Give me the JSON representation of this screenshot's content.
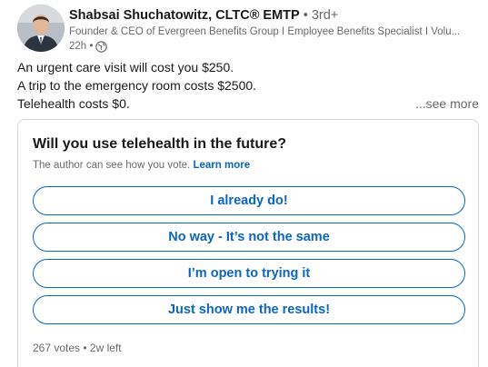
{
  "author": {
    "name": "Shabsai Shuchatowitz, CLTC® EMTP",
    "degree": " • 3rd+",
    "headline": "Founder & CEO of Evergreen Benefits Group I Employee Benefits Specialist I Volu...",
    "time": "22h •",
    "visibility_icon": "globe-icon"
  },
  "post": {
    "lines": [
      "An urgent care visit will cost you $250.",
      "A trip to the emergency room costs $2500.",
      "Telehealth costs $0."
    ],
    "see_more": "...see more"
  },
  "poll": {
    "question": "Will you use telehealth in the future?",
    "note": "The author can see how you vote.",
    "learn_more": "Learn more",
    "options": [
      "I already do!",
      "No way - It’s not the same",
      "I’m open to trying it",
      "Just show me the results!"
    ],
    "votes": "267 votes",
    "separator": " • ",
    "time_left": "2w left"
  },
  "colors": {
    "accent": "#0a66c2",
    "muted": "#666666",
    "border": "#d6d6d6"
  }
}
